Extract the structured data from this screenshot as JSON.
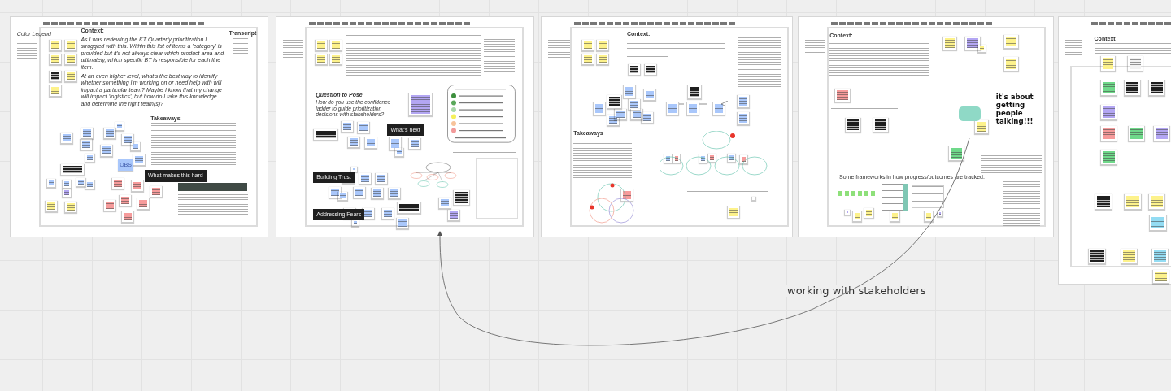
{
  "frames": [
    {
      "legend_title": "Color Legend",
      "context_heading": "Context:",
      "context_paragraphs": [
        "As I was reviewing the KT Quarterly prioritization I struggled with this. Within this list of items a 'category' is provided but it's not always clear which product area and, ultimately, which specific BT is responsible for each line item.",
        "At an even higher level, what's the best way to identify whether something I'm working on or need help with will impact a particular team? Maybe I know that my change will impact 'logistics', but how do I take this knowledge and determine the right team(s)?"
      ],
      "transcript_heading": "Transcript",
      "takeaways_heading": "Takeaways",
      "blue_note": "OBS",
      "black_note": "What makes this hard"
    },
    {
      "question_heading": "Question to Pose",
      "question": "How do you use the confidence ladder to guide prioritization decisions with stakeholders?",
      "black_notes": [
        "What's next",
        "Building Trust",
        "Addressing Fears"
      ]
    },
    {
      "context_heading": "Context:",
      "takeaways_heading": "Takeaways"
    },
    {
      "context_heading": "Context:",
      "callout": "it's about getting people talking!!!",
      "frameworks_caption": "Some frameworks in how progress/outcomes are tracked."
    },
    {
      "context_heading": "Context"
    }
  ],
  "connector_label": "working with stakeholders"
}
